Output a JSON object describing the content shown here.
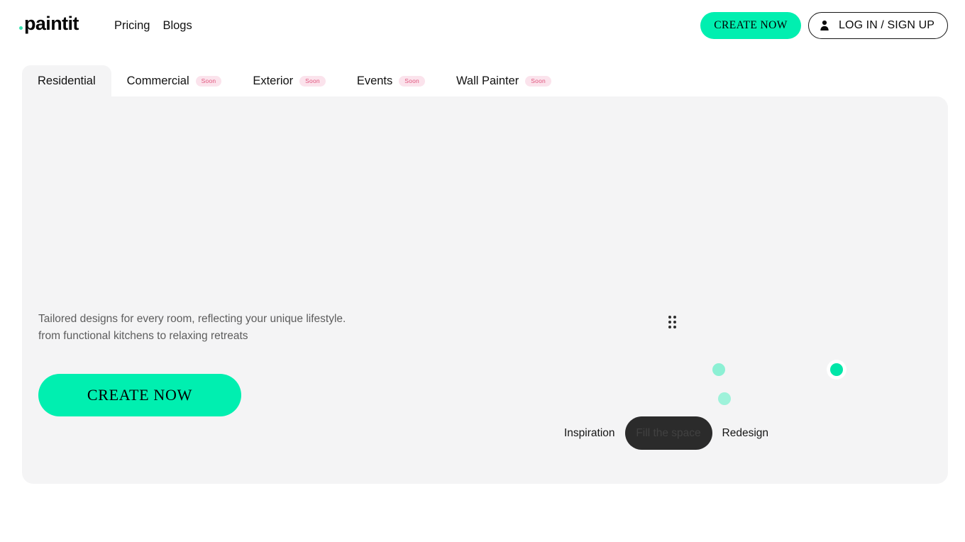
{
  "header": {
    "logo": {
      "dot": "logo-dot",
      "name": "paintit"
    },
    "nav": [
      {
        "label": "Pricing"
      },
      {
        "label": "Blogs"
      }
    ],
    "create_button": "CREATE NOW",
    "login_button": "LOG IN / SIGN UP",
    "login_icon": "person-icon"
  },
  "tabs": [
    {
      "label": "Residential",
      "badge": "",
      "active": true
    },
    {
      "label": "Commercial",
      "badge": "Soon",
      "active": false
    },
    {
      "label": "Exterior",
      "badge": "Soon",
      "active": false
    },
    {
      "label": "Events",
      "badge": "Soon",
      "active": false
    },
    {
      "label": "Wall Painter",
      "badge": "Soon",
      "active": false
    }
  ],
  "main": {
    "caption": "Tailored designs for every room, reflecting your unique lifestyle.\nfrom functional kitchens to relaxing retreats",
    "create_button": "CREATE NOW",
    "drag_handle_icon": "drag-handle-icon",
    "modes": [
      {
        "label": "Inspiration",
        "style": "plain"
      },
      {
        "label": "Fill the space",
        "style": "pill"
      },
      {
        "label": "Redesign",
        "style": "plain"
      }
    ]
  },
  "colors": {
    "accent_green": "#00efb0",
    "dot_active": "#00e6a8",
    "dot_mint": "#9ef2da",
    "badge_bg": "#fbe3ec",
    "badge_text": "#e0557d",
    "card_bg": "#f4f4f5",
    "pill_dark": "#2b2b2b"
  }
}
